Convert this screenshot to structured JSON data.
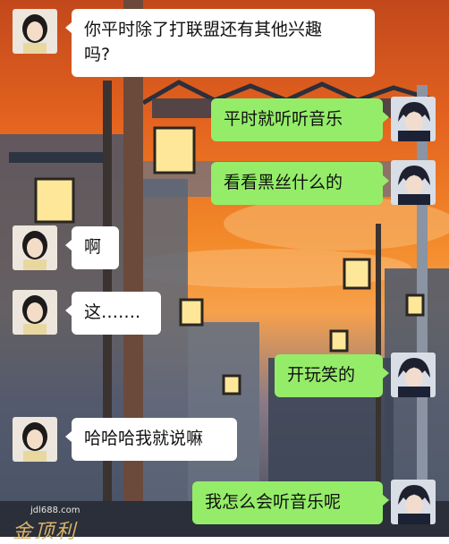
{
  "messages": [
    {
      "side": "left",
      "text": "你平时除了打联盟还有其他兴趣\n吗?"
    },
    {
      "side": "right",
      "text": "平时就听听音乐"
    },
    {
      "side": "right",
      "text": "看看黑丝什么的"
    },
    {
      "side": "left",
      "text": "啊"
    },
    {
      "side": "left",
      "text": "这……."
    },
    {
      "side": "right",
      "text": "开玩笑的"
    },
    {
      "side": "left",
      "text": "哈哈哈我就说嘛"
    },
    {
      "side": "right",
      "text": "我怎么会听音乐呢"
    }
  ],
  "watermark": {
    "url": "jdl688.com",
    "text": "金顶利"
  },
  "colors": {
    "left_bubble": "#ffffff",
    "right_bubble": "#95ec69"
  }
}
